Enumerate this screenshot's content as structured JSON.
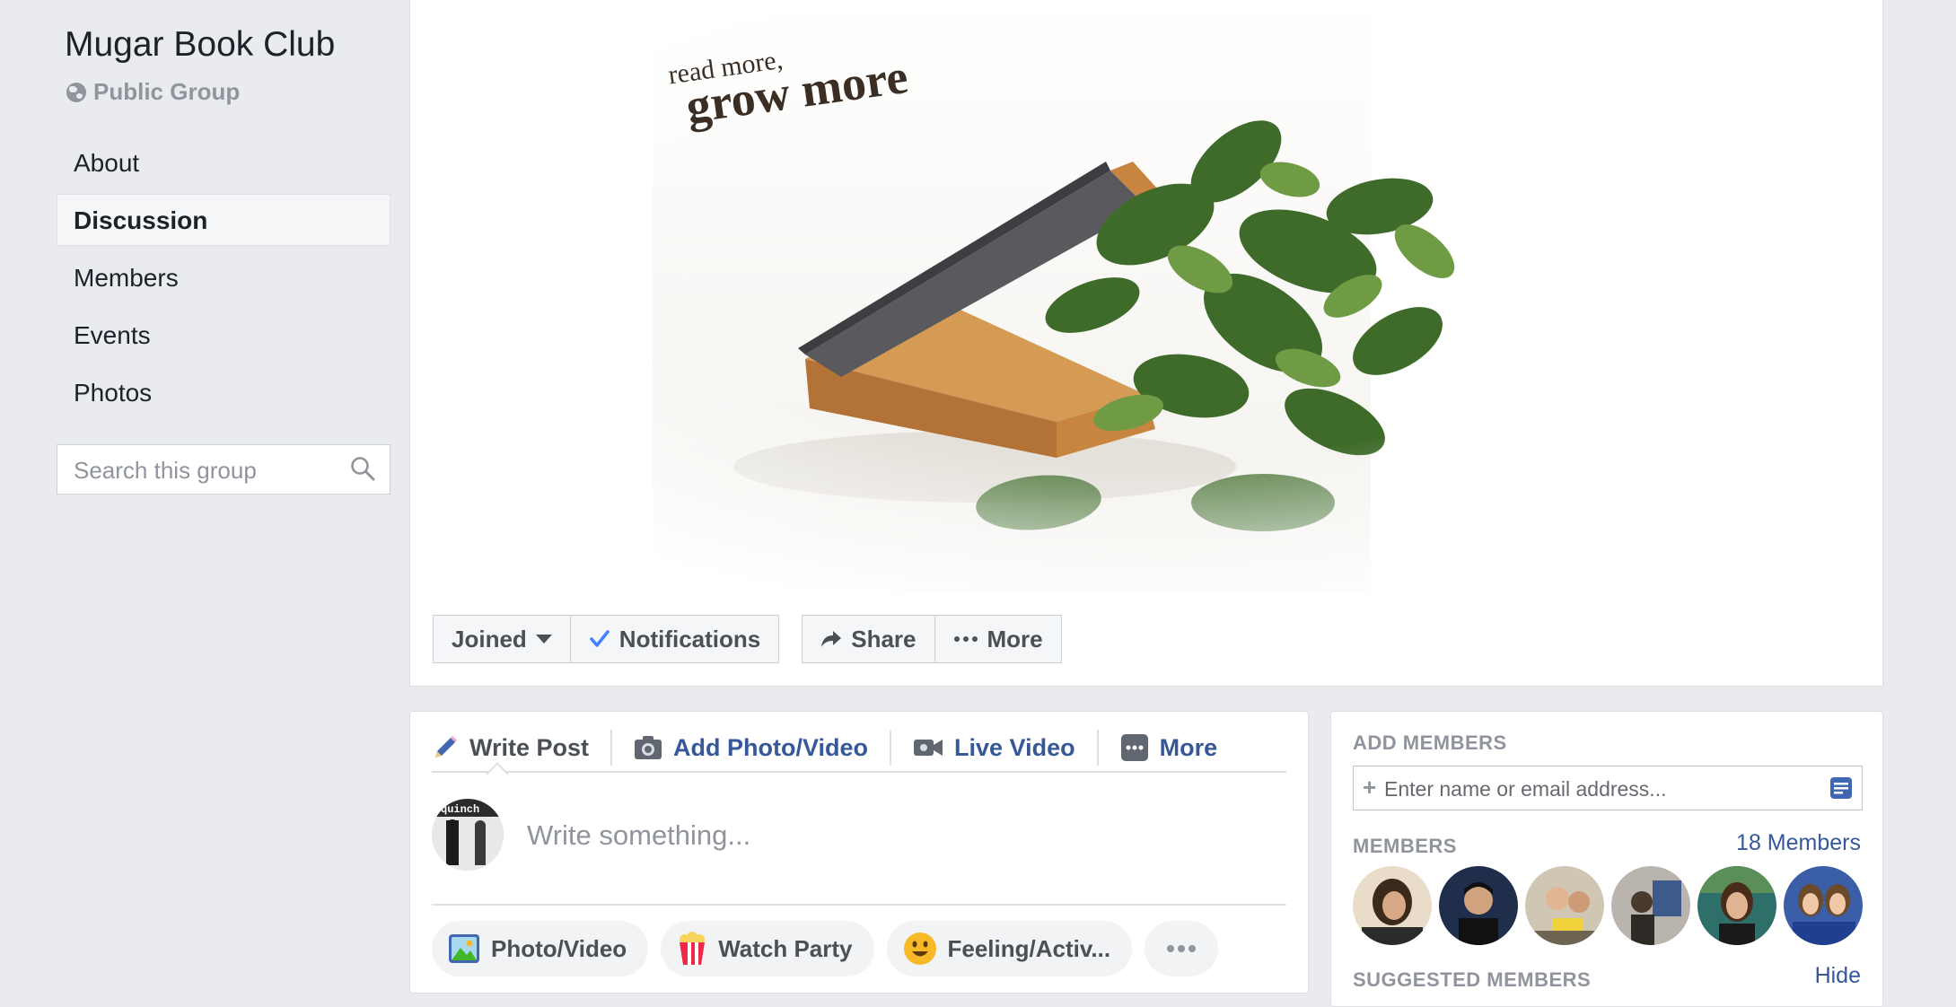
{
  "group": {
    "title": "Mugar Book Club",
    "privacy": "Public Group",
    "privacy_icon": "globe-icon"
  },
  "nav": {
    "items": [
      {
        "label": "About",
        "active": false
      },
      {
        "label": "Discussion",
        "active": true
      },
      {
        "label": "Members",
        "active": false
      },
      {
        "label": "Events",
        "active": false
      },
      {
        "label": "Photos",
        "active": false
      }
    ]
  },
  "search": {
    "placeholder": "Search this group",
    "icon": "search-icon"
  },
  "cover": {
    "tagline_small": "read more,",
    "tagline_large": "grow more"
  },
  "actions": {
    "joined": "Joined",
    "notifications": "Notifications",
    "share": "Share",
    "more": "More"
  },
  "composer": {
    "tabs": {
      "write_post": "Write Post",
      "add_photo": "Add Photo/Video",
      "live_video": "Live Video",
      "more": "More"
    },
    "placeholder": "Write something...",
    "pills": {
      "photo_video": "Photo/Video",
      "watch_party": "Watch Party",
      "feeling": "Feeling/Activ..."
    },
    "avatar_text": "quinch"
  },
  "members_card": {
    "add_header": "ADD MEMBERS",
    "add_placeholder": "Enter name or email address...",
    "members_header": "MEMBERS",
    "members_count": "18 Members",
    "suggested_header": "SUGGESTED MEMBERS",
    "hide": "Hide"
  },
  "colors": {
    "background": "#e9ebee",
    "link": "#365899",
    "check": "#4080ff",
    "muted": "#90949c"
  }
}
